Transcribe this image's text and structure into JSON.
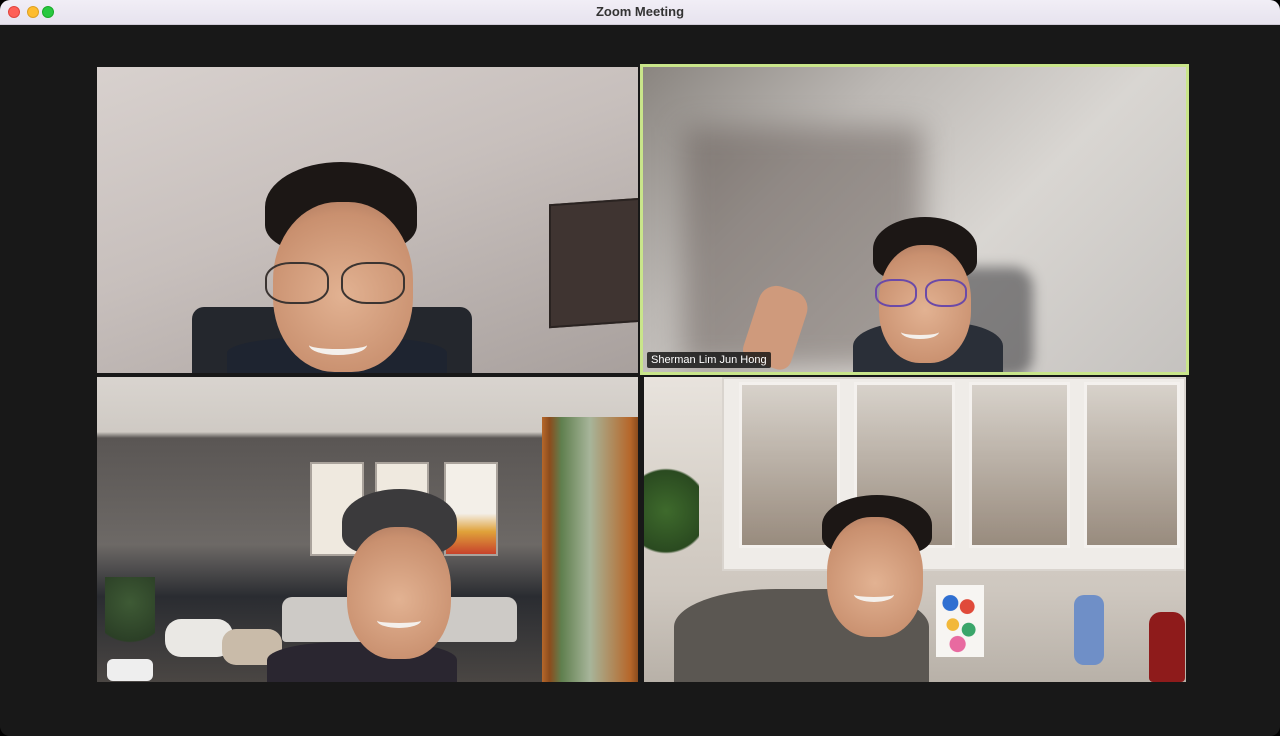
{
  "window": {
    "title": "Zoom Meeting"
  },
  "colors": {
    "active_speaker_border": "#c9e58a",
    "stage_background": "#181818",
    "close": "#fe5f57",
    "minimize": "#febc2e",
    "maximize": "#28c840"
  },
  "tiles": [
    {
      "position": "top-left",
      "name": "",
      "active_speaker": false
    },
    {
      "position": "top-right",
      "name": "Sherman Lim Jun Hong",
      "active_speaker": true
    },
    {
      "position": "bottom-left",
      "name": "",
      "active_speaker": false
    },
    {
      "position": "bottom-right",
      "name": "",
      "active_speaker": false
    }
  ]
}
